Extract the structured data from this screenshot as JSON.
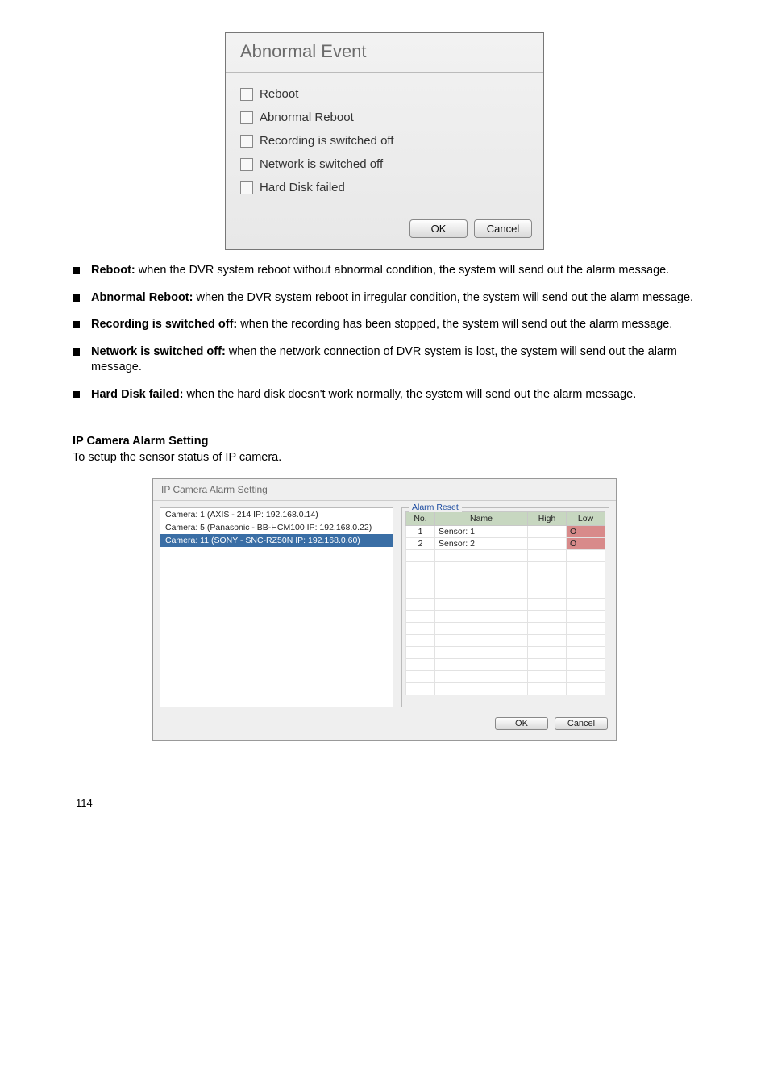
{
  "abnormal": {
    "title": "Abnormal Event",
    "options": [
      {
        "label": "Reboot"
      },
      {
        "label": "Abnormal Reboot"
      },
      {
        "label": "Recording is switched off"
      },
      {
        "label": "Network is switched off"
      },
      {
        "label": "Hard Disk failed"
      }
    ],
    "ok": "OK",
    "cancel": "Cancel"
  },
  "bullets": [
    {
      "bold": "Reboot:",
      "text": " when the DVR system reboot without abnormal condition, the system will send out the alarm message."
    },
    {
      "bold": "Abnormal Reboot:",
      "text": " when the DVR system reboot in irregular condition, the system will send out the alarm message."
    },
    {
      "bold": "Recording is switched off:",
      "text": " when the recording has been stopped, the system will send out the alarm message."
    },
    {
      "bold": "Network is switched off:",
      "text": " when the network connection of DVR system is lost, the system will send out the alarm message."
    },
    {
      "bold": "Hard Disk failed:",
      "text": " when the hard disk doesn't work normally, the system will send out the alarm message."
    }
  ],
  "ipalarm_intro": {
    "header": "IP Camera Alarm Setting",
    "text": "To setup the sensor status of IP camera."
  },
  "ipalarm": {
    "title": "IP Camera Alarm Setting",
    "cameras": [
      {
        "label": "Camera: 1 (AXIS - 214 IP: 192.168.0.14)",
        "selected": false
      },
      {
        "label": "Camera: 5 (Panasonic - BB-HCM100 IP: 192.168.0.22)",
        "selected": false
      },
      {
        "label": "Camera: 11 (SONY - SNC-RZ50N IP: 192.168.0.60)",
        "selected": true
      }
    ],
    "alarm_reset_legend": "Alarm Reset",
    "headers": {
      "no": "No.",
      "name": "Name",
      "high": "High",
      "low": "Low"
    },
    "rows": [
      {
        "no": "1",
        "name": "Sensor: 1",
        "high": "",
        "low": "O"
      },
      {
        "no": "2",
        "name": "Sensor: 2",
        "high": "",
        "low": "O"
      }
    ],
    "ok": "OK",
    "cancel": "Cancel"
  },
  "footer": {
    "left": "114",
    "right": ""
  }
}
